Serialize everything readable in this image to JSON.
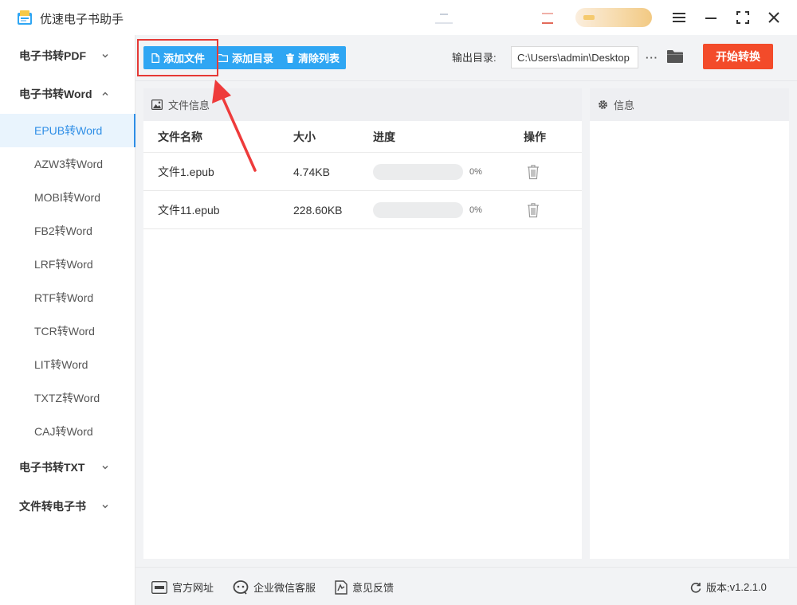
{
  "app": {
    "title": "优速电子书助手"
  },
  "sidebar": {
    "groups": [
      {
        "label": "电子书转PDF",
        "expanded": false
      },
      {
        "label": "电子书转Word",
        "expanded": true
      },
      {
        "label": "电子书转TXT",
        "expanded": false
      },
      {
        "label": "文件转电子书",
        "expanded": false
      }
    ],
    "items": [
      {
        "label": "EPUB转Word",
        "active": true
      },
      {
        "label": "AZW3转Word"
      },
      {
        "label": "MOBI转Word"
      },
      {
        "label": "FB2转Word"
      },
      {
        "label": "LRF转Word"
      },
      {
        "label": "RTF转Word"
      },
      {
        "label": "TCR转Word"
      },
      {
        "label": "LIT转Word"
      },
      {
        "label": "TXTZ转Word"
      },
      {
        "label": "CAJ转Word"
      }
    ]
  },
  "toolbar": {
    "add_file": "添加文件",
    "add_folder": "添加目录",
    "clear_list": "清除列表",
    "output_label": "输出目录:",
    "output_value": "C:\\Users\\admin\\Desktop",
    "more": "···",
    "start": "开始转换"
  },
  "file_panel": {
    "title": "文件信息",
    "columns": [
      "文件名称",
      "大小",
      "进度",
      "操作"
    ],
    "rows": [
      {
        "name": "文件1.epub",
        "size": "4.74KB",
        "progress": 0,
        "progress_label": "0%"
      },
      {
        "name": "文件11.epub",
        "size": "228.60KB",
        "progress": 0,
        "progress_label": "0%"
      }
    ]
  },
  "info_panel": {
    "title": "信息"
  },
  "footer": {
    "website": "官方网址",
    "wechat": "企业微信客服",
    "feedback": "意见反馈",
    "version_label": "版本:",
    "version": "v1.2.1.0"
  },
  "colors": {
    "accent_blue": "#2fa6f3",
    "start_red": "#f34b2a",
    "highlight_red": "#e53935",
    "active_bg": "#e9f4fd"
  }
}
